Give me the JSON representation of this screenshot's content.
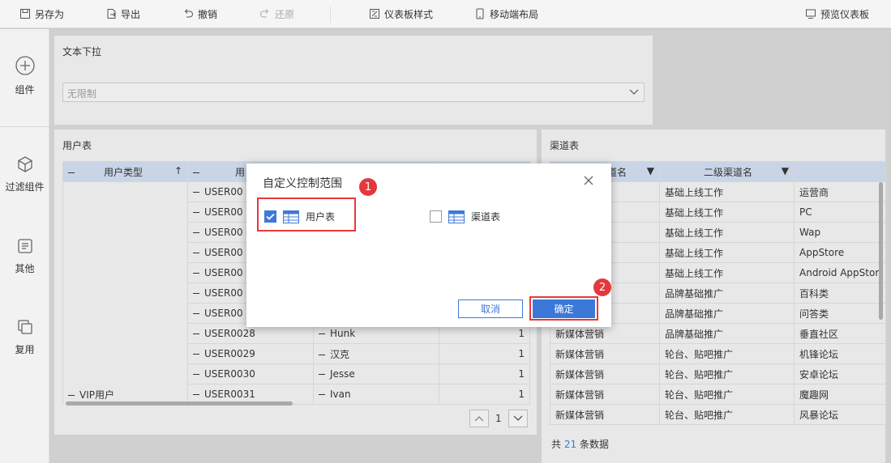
{
  "toolbar": {
    "save_as": "另存为",
    "export": "导出",
    "undo": "撤销",
    "redo": "还原",
    "dashboard_style": "仪表板样式",
    "mobile_layout": "移动端布局",
    "preview": "预览仪表板"
  },
  "rail": {
    "components": "组件",
    "filter_components": "过滤组件",
    "other": "其他",
    "reuse": "复用"
  },
  "dropdown_panel": {
    "title": "文本下拉",
    "value": "无限制"
  },
  "user_table": {
    "title": "用户表",
    "headers": [
      "用户类型",
      "用",
      "",
      ""
    ],
    "rows": [
      {
        "type": "",
        "id": "USER00",
        "name": "",
        "count": ""
      },
      {
        "type": "",
        "id": "USER00",
        "name": "",
        "count": ""
      },
      {
        "type": "",
        "id": "USER00",
        "name": "",
        "count": ""
      },
      {
        "type": "",
        "id": "USER00",
        "name": "",
        "count": ""
      },
      {
        "type": "",
        "id": "USER00",
        "name": "",
        "count": ""
      },
      {
        "type": "",
        "id": "USER00",
        "name": "",
        "count": ""
      },
      {
        "type": "",
        "id": "USER00",
        "name": "",
        "count": ""
      },
      {
        "type": "",
        "id": "USER0028",
        "name": "Hunk",
        "count": "1"
      },
      {
        "type": "",
        "id": "USER0029",
        "name": "汉克",
        "count": "1"
      },
      {
        "type": "",
        "id": "USER0030",
        "name": "Jesse",
        "count": "1"
      },
      {
        "type": "VIP用户",
        "id": "USER0031",
        "name": "Ivan",
        "count": "1"
      }
    ],
    "page": "1"
  },
  "channel_table": {
    "title": "渠道表",
    "headers": [
      "道名",
      "二级渠道名",
      ""
    ],
    "rows": [
      {
        "c1": "",
        "c2": "基础上线工作",
        "c3": "运营商"
      },
      {
        "c1": "",
        "c2": "基础上线工作",
        "c3": "PC"
      },
      {
        "c1": "",
        "c2": "基础上线工作",
        "c3": "Wap"
      },
      {
        "c1": "",
        "c2": "基础上线工作",
        "c3": "AppStore"
      },
      {
        "c1": "",
        "c2": "基础上线工作",
        "c3": "Android AppStor"
      },
      {
        "c1": "",
        "c2": "品牌基础推广",
        "c3": "百科类"
      },
      {
        "c1": "",
        "c2": "品牌基础推广",
        "c3": "问答类"
      },
      {
        "c1": "新媒体营销",
        "c2": "品牌基础推广",
        "c3": "垂直社区"
      },
      {
        "c1": "新媒体营销",
        "c2": "轮台、贴吧推广",
        "c3": "机锋论坛"
      },
      {
        "c1": "新媒体营销",
        "c2": "轮台、贴吧推广",
        "c3": "安卓论坛"
      },
      {
        "c1": "新媒体营销",
        "c2": "轮台、贴吧推广",
        "c3": "魔趣网"
      },
      {
        "c1": "新媒体营销",
        "c2": "轮台、贴吧推广",
        "c3": "风暴论坛"
      }
    ],
    "footer_prefix": "共",
    "footer_count": "21",
    "footer_suffix": "条数据"
  },
  "dialog": {
    "title": "自定义控制范围",
    "options": [
      {
        "label": "用户表",
        "checked": true
      },
      {
        "label": "渠道表",
        "checked": false
      }
    ],
    "cancel": "取消",
    "confirm": "确定",
    "badge1": "1",
    "badge2": "2"
  },
  "colors": {
    "accent": "#3c78d8",
    "highlight": "#e4393c",
    "header_bg": "#c9d5e6"
  }
}
